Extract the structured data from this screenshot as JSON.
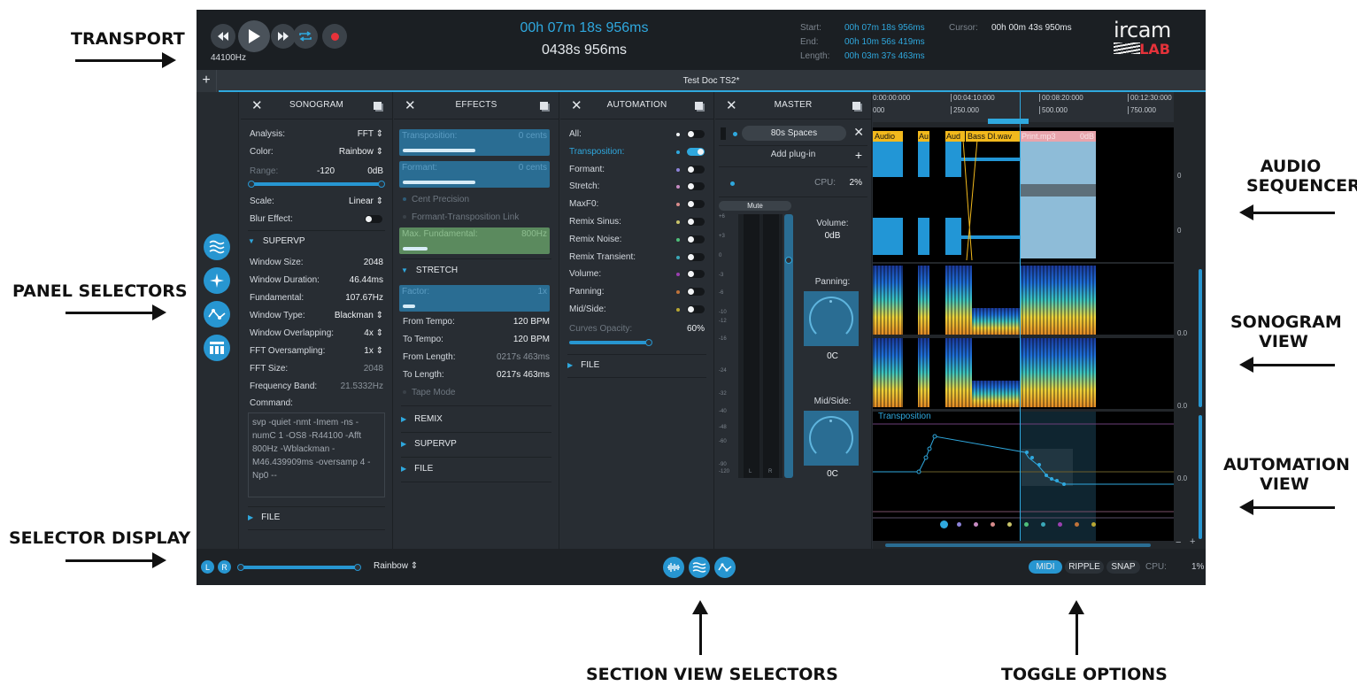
{
  "callouts": {
    "transport": "TRANSPORT",
    "panel_selectors": "PANEL SELECTORS",
    "selector_display": "SELECTOR DISPLAY",
    "audio_sequencer_1": "AUDIO",
    "audio_sequencer_2": "SEQUENCER",
    "sonogram_view_1": "SONOGRAM",
    "sonogram_view_2": "VIEW",
    "automation_view_1": "AUTOMATION",
    "automation_view_2": "VIEW",
    "section_view_selectors": "SECTION VIEW SELECTORS",
    "toggle_options": "TOGGLE OPTIONS"
  },
  "transport": {
    "sample_rate": "44100Hz",
    "time_main": "00h 07m 18s 956ms",
    "time_sub": "0438s 956ms",
    "start_label": "Start:",
    "start_value": "00h 07m 18s 956ms",
    "end_label": "End:",
    "end_value": "00h 10m 56s 419ms",
    "length_label": "Length:",
    "length_value": "00h 03m 37s 463ms",
    "cursor_label": "Cursor:",
    "cursor_value": "00h 00m 43s 950ms",
    "logo_top": "ircam",
    "logo_bottom": "LAB"
  },
  "document": {
    "add_label": "+",
    "title": "Test Doc TS2*"
  },
  "sonogram": {
    "title": "SONOGRAM",
    "analysis_label": "Analysis:",
    "analysis_value": "FFT ⇕",
    "color_label": "Color:",
    "color_value": "Rainbow ⇕",
    "range_label": "Range:",
    "range_min": "-120",
    "range_max": "0dB",
    "scale_label": "Scale:",
    "scale_value": "Linear ⇕",
    "blur_label": "Blur Effect:",
    "supervp_label": "SUPERVP",
    "window_size_label": "Window Size:",
    "window_size_value": "2048",
    "window_duration_label": "Window Duration:",
    "window_duration_value": "46.44ms",
    "fundamental_label": "Fundamental:",
    "fundamental_value": "107.67Hz",
    "window_type_label": "Window Type:",
    "window_type_value": "Blackman ⇕",
    "window_overlap_label": "Window Overlapping:",
    "window_overlap_value": "4x ⇕",
    "fft_oversampling_label": "FFT Oversampling:",
    "fft_oversampling_value": "1x ⇕",
    "fft_size_label": "FFT Size:",
    "fft_size_value": "2048",
    "frequency_band_label": "Frequency Band:",
    "frequency_band_value": "21.5332Hz",
    "command_label": "Command:",
    "command_text": "svp -quiet -nmt -Imem -ns -numC 1 -OS8 -R44100 -Afft 800Hz -Wblackman -M46.439909ms -oversamp 4 -Np0 --",
    "file_label": "FILE"
  },
  "effects": {
    "title": "EFFECTS",
    "transposition_label": "Transposition:",
    "transposition_value": "0 cents",
    "formant_label": "Formant:",
    "formant_value": "0 cents",
    "cent_precision": "Cent Precision",
    "formant_link": "Formant-Transposition Link",
    "max_fundamental_label": "Max. Fundamental:",
    "max_fundamental_value": "800Hz",
    "stretch_label": "STRETCH",
    "factor_label": "Factor:",
    "factor_value": "1x",
    "from_tempo_label": "From Tempo:",
    "from_tempo_value": "120 BPM",
    "to_tempo_label": "To Tempo:",
    "to_tempo_value": "120 BPM",
    "from_length_label": "From Length:",
    "from_length_value": "0217s  463ms",
    "to_length_label": "To Length:",
    "to_length_value": "0217s  463ms",
    "tape_mode": "Tape Mode",
    "remix_label": "REMIX",
    "supervp_label": "SUPERVP",
    "file_label": "FILE"
  },
  "automation": {
    "title": "AUTOMATION",
    "items": [
      {
        "label": "All:",
        "color": "#f1f3f5",
        "on": false
      },
      {
        "label": "Transposition:",
        "color": "#2fa8de",
        "on": true
      },
      {
        "label": "Formant:",
        "color": "#8d83d9",
        "on": false
      },
      {
        "label": "Stretch:",
        "color": "#c78bc3",
        "on": false
      },
      {
        "label": "MaxF0:",
        "color": "#d88b8b",
        "on": false
      },
      {
        "label": "Remix Sinus:",
        "color": "#c9c46a",
        "on": false
      },
      {
        "label": "Remix Noise:",
        "color": "#4fbf7a",
        "on": false
      },
      {
        "label": "Remix Transient:",
        "color": "#3aa8b8",
        "on": false
      },
      {
        "label": "Volume:",
        "color": "#9b3fb0",
        "on": false
      },
      {
        "label": "Panning:",
        "color": "#c0733a",
        "on": false
      },
      {
        "label": "Mid/Side:",
        "color": "#b8a733",
        "on": false
      }
    ],
    "curves_opacity_label": "Curves Opacity:",
    "curves_opacity_value": "60%",
    "file_label": "FILE"
  },
  "master": {
    "title": "MASTER",
    "plugin_name": "80s Spaces",
    "add_plugin": "Add plug-in",
    "cpu_label": "CPU:",
    "cpu_value": "2%",
    "mute_label": "Mute",
    "meter_ticks": [
      "+6",
      "+3",
      "0",
      "-3",
      "-6",
      "-10",
      "-12",
      "-16",
      "-24",
      "-32",
      "-40",
      "-48",
      "-60",
      "-90",
      "-120"
    ],
    "channel_l": "L",
    "channel_r": "R",
    "volume_label": "Volume:",
    "volume_value": "0dB",
    "panning_label": "Panning:",
    "panning_value": "0C",
    "midside_label": "Mid/Side:",
    "midside_value": "0C"
  },
  "sequencer": {
    "ruler_time": [
      "0:00:00:000",
      "00:04:10:000",
      "00:08:20:000",
      "00:12:30:000"
    ],
    "ruler_samples": [
      "000",
      "250.000",
      "500.000",
      "750.000"
    ],
    "clips": [
      "Audio",
      "Au",
      "Aud",
      "Bass DI.wav",
      "Print.mp3",
      "0dB"
    ],
    "scale_labels": [
      "0",
      "0",
      "0.0",
      "0.0",
      "0.0"
    ],
    "automation_label": "Transposition",
    "zoom_minus": "−",
    "zoom_plus": "+",
    "point_colors": [
      "#2fa8de",
      "#8d83d9",
      "#c78bc3",
      "#d88b8b",
      "#c9c46a",
      "#4fbf7a",
      "#3aa8b8",
      "#9b3fb0",
      "#c0733a",
      "#b8a733"
    ]
  },
  "bottom": {
    "channel_l": "L",
    "channel_r": "R",
    "colormap_value": "Rainbow ⇕",
    "midi": "MIDI",
    "ripple": "RIPPLE",
    "snap": "SNAP",
    "cpu_label": "CPU:",
    "cpu_value": "1%"
  },
  "colors": {
    "accent": "#2fa8de",
    "background": "#282d33",
    "topbar": "#1b1f23",
    "record": "#e8323a",
    "clip_yellow": "#f2b91d",
    "clip_pink": "#e8a4ac"
  }
}
